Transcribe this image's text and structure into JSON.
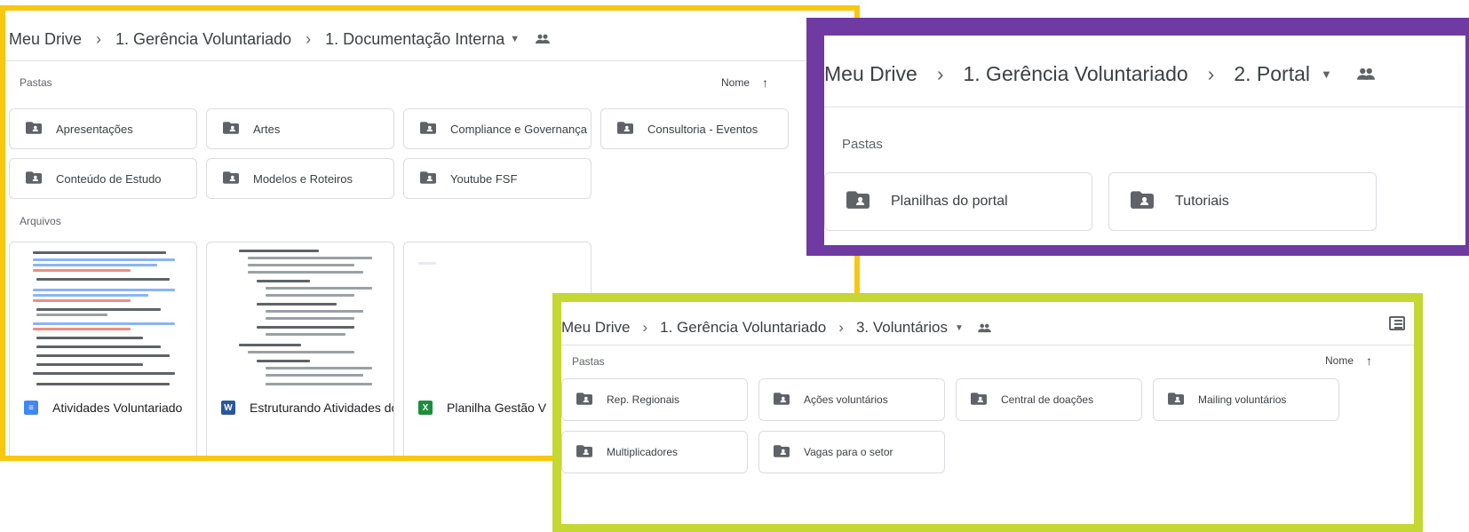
{
  "panel1": {
    "breadcrumb": {
      "root": "Meu Drive",
      "level1": "1. Gerência Voluntariado",
      "current": "1. Documentação Interna"
    },
    "folders_label": "Pastas",
    "sort_label": "Nome",
    "folders": [
      "Apresentações",
      "Artes",
      "Compliance e Governança",
      "Consultoria - Eventos",
      "Conteúdo de Estudo",
      "Modelos e Roteiros",
      "Youtube FSF"
    ],
    "files_label": "Arquivos",
    "files": [
      {
        "name": "Atividades Voluntariado",
        "type": "docs",
        "icon_color": "#4285f4"
      },
      {
        "name": "Estruturando Atividades do...",
        "type": "word",
        "icon_color": "#2b579a",
        "icon_letter": "W"
      },
      {
        "name": "Planilha Gestão V",
        "type": "excel",
        "icon_color": "#1e8e3e",
        "icon_letter": "X"
      }
    ],
    "accent": "#f9c711"
  },
  "panel2": {
    "breadcrumb": {
      "root": "Meu Drive",
      "level1": "1. Gerência Voluntariado",
      "current": "2. Portal"
    },
    "folders_label": "Pastas",
    "folders": [
      "Planilhas do portal",
      "Tutoriais"
    ],
    "accent": "#6f3aa1"
  },
  "panel3": {
    "breadcrumb": {
      "root": "Meu Drive",
      "level1": "1. Gerência Voluntariado",
      "current": "3. Voluntários"
    },
    "folders_label": "Pastas",
    "sort_label": "Nome",
    "folders": [
      "Rep. Regionais",
      "Ações voluntários",
      "Central de doações",
      "Mailing voluntários",
      "Multiplicadores",
      "Vagas para o setor"
    ],
    "accent": "#c4d733"
  },
  "icons": {
    "separator": "›",
    "caret": "▼",
    "sort_arrow": "↑",
    "shared_folder": "shared-folder-icon",
    "people": "people-icon"
  }
}
